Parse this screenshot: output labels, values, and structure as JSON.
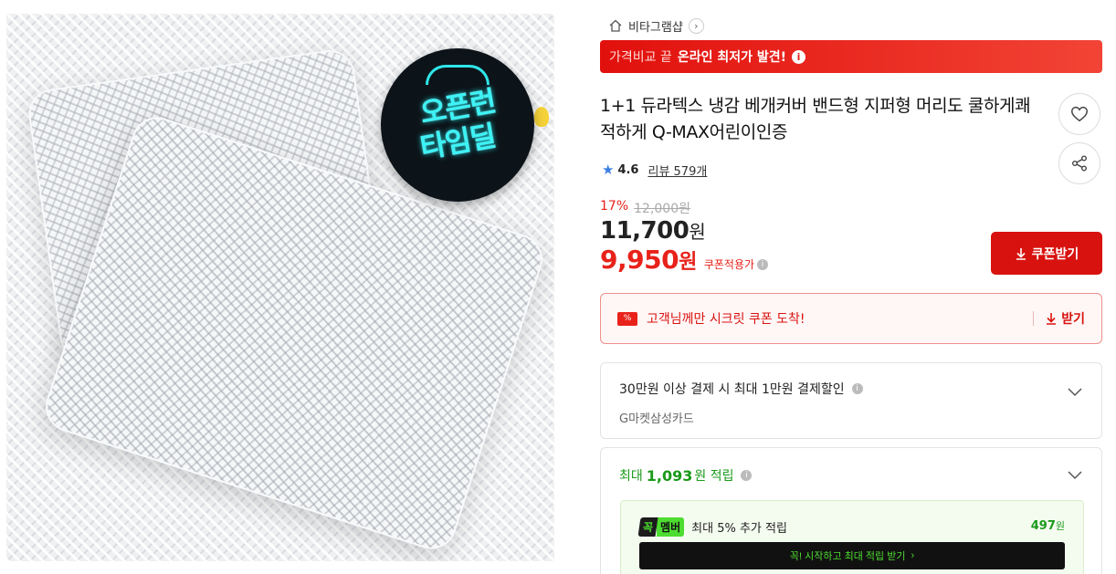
{
  "product_image": {
    "promo_badge_line1": "오픈런",
    "promo_badge_line2": "타임딜"
  },
  "store": {
    "name": "비타그램샵"
  },
  "price_banner": {
    "prefix": "가격비교 끝",
    "highlight": "온라인 최저가 발견!"
  },
  "product": {
    "title": "1+1 듀라텍스 냉감 베개커버 밴드형 지퍼형 머리도 쿨하게쾌적하게 Q-MAX어린이인증",
    "rating": "4.6",
    "review_label": "리뷰 579개"
  },
  "pricing": {
    "discount_rate": "17%",
    "original_price": "12,000원",
    "sale_price": "11,700",
    "sale_unit": "원",
    "coupon_price": "9,950",
    "coupon_unit": "원",
    "coupon_applied_label": "쿠폰적용가",
    "coupon_button_label": "쿠폰받기"
  },
  "secret_coupon": {
    "ticket_glyph": "%",
    "message": "고객님께만 시크릿 쿠폰 도착!",
    "receive_label": "받기"
  },
  "card_benefit": {
    "title": "30만원 이상 결제 시 최대 1만원 결제할인",
    "subtitle": "G마켓삼성카드"
  },
  "points": {
    "prefix": "최대",
    "amount": "1,093",
    "suffix": "원 적립",
    "member_badge_k": "꼭",
    "member_badge_m": "멤버",
    "member_text": "최대 5% 추가 적립",
    "member_points": "497",
    "member_points_unit": "원",
    "cta_label": "꼭! 시작하고 최대 적립 받기"
  },
  "colors": {
    "brand_red": "#d8130f",
    "points_green": "#1a9a1a",
    "member_green": "#4ddc30",
    "rating_star": "#3b7fe3"
  },
  "icons": [
    "home-icon",
    "chevron-right-icon",
    "info-icon",
    "heart-icon",
    "share-icon",
    "star-icon",
    "download-arrow-icon",
    "coupon-ticket-icon",
    "chevron-down-icon"
  ]
}
